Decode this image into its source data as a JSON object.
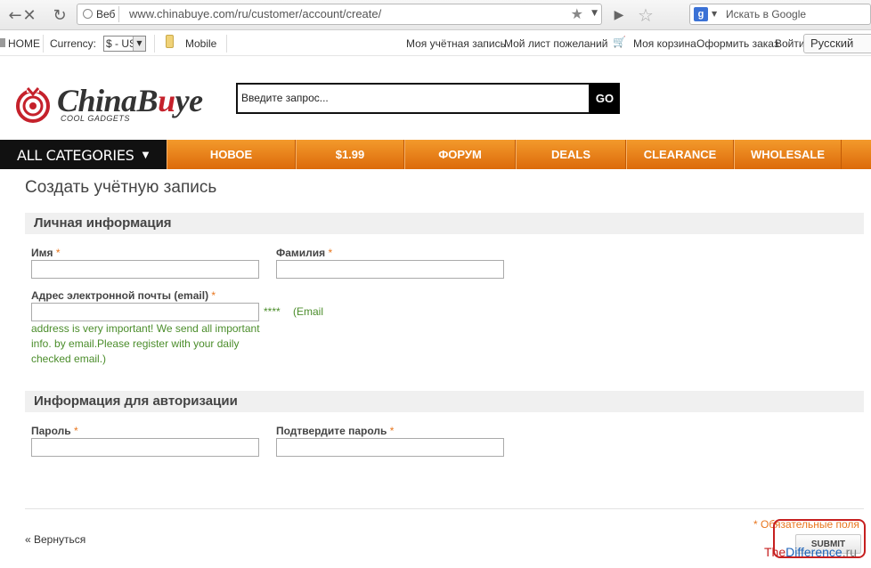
{
  "browser": {
    "url_tag": "Веб",
    "url": "www.chinabuye.com/ru/customer/account/create/",
    "search_placeholder": "Искать в Google"
  },
  "topbar": {
    "home": "HOME",
    "currency_label": "Currency:",
    "currency_value": "$ - US",
    "mobile": "Mobile",
    "my_account": "Моя учётная запись",
    "wishlist": "Мой лист пожеланий",
    "cart": "Моя корзина",
    "checkout": "Оформить заказ",
    "login": "Войти",
    "language": "Русский"
  },
  "header": {
    "logo_main": "ChinaB",
    "logo_u": "u",
    "logo_end": "ye",
    "logo_tagline": "COOL GADGETS",
    "search_placeholder": "Введите запрос...",
    "search_button": "GO"
  },
  "nav": {
    "all_categories": "ALL CATEGORIES",
    "items": [
      "НОВОЕ",
      "$1.99",
      "ФОРУМ",
      "DEALS",
      "CLEARANCE",
      "WHOLESALE"
    ]
  },
  "form": {
    "title": "Создать учётную запись",
    "personal_section": "Личная информация",
    "first_name": "Имя",
    "last_name": "Фамилия",
    "email": "Адрес электронной почты (email)",
    "required_mark": "*",
    "email_stars": "****",
    "email_note_start": "(Email",
    "email_note_rest": "address is very important! We send all important info. by email.Please register with your daily checked email.)",
    "auth_section": "Информация для авторизации",
    "password": "Пароль",
    "confirm_password": "Подтвердите пароль",
    "back_link": "« Вернуться",
    "required_note": "* Обязательные поля",
    "submit": "SUBMIT"
  },
  "watermark": {
    "part1": "The",
    "part2": "Difference",
    "part3": ".ru"
  },
  "colors": {
    "nav_orange": "#e8801c",
    "required": "#e8761e",
    "note_green": "#4b8d2b",
    "logo_red": "#c5212b"
  }
}
